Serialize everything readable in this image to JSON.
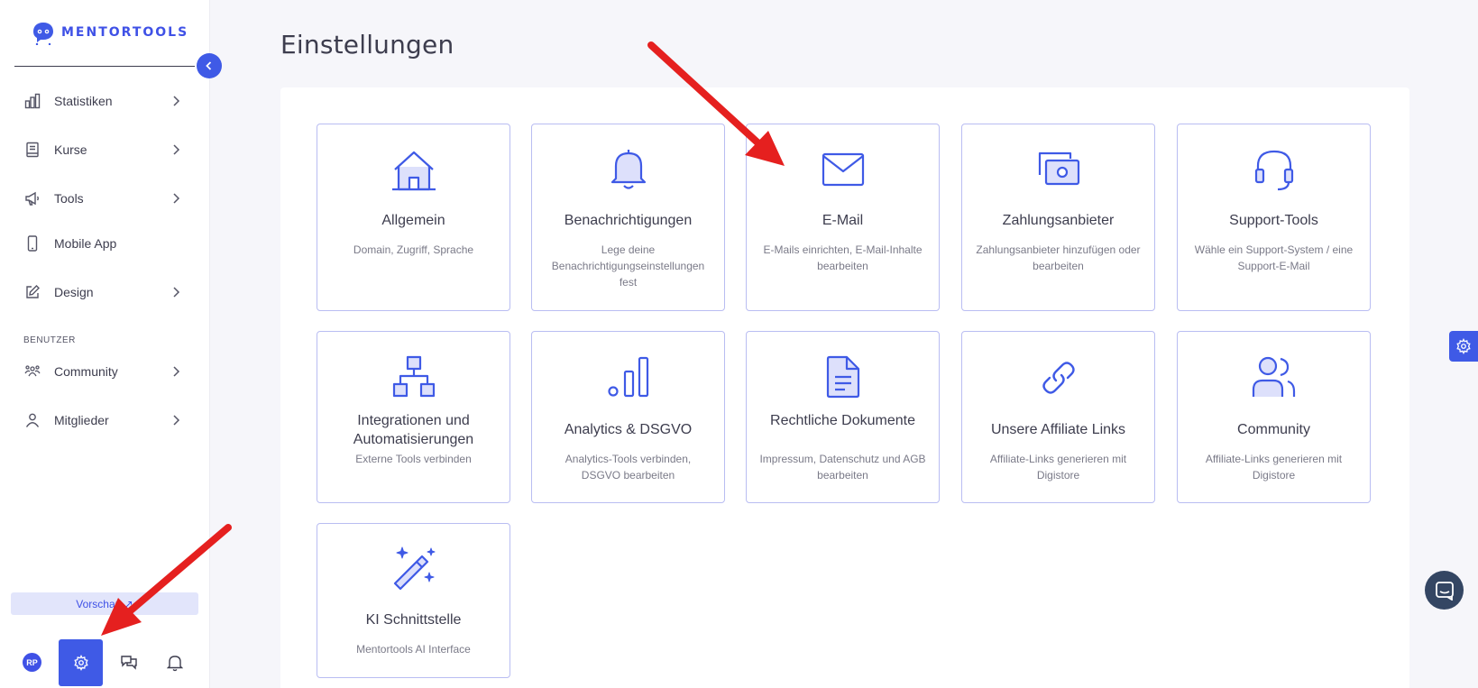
{
  "brand": {
    "name": "MENTORTOOLS",
    "accent": "#3f5ae6"
  },
  "sidebar": {
    "items": [
      {
        "label": "Statistiken",
        "icon": "bar-chart-icon"
      },
      {
        "label": "Kurse",
        "icon": "book-icon"
      },
      {
        "label": "Tools",
        "icon": "megaphone-icon"
      },
      {
        "label": "Mobile App",
        "icon": "smartphone-icon"
      },
      {
        "label": "Design",
        "icon": "pen-square-icon"
      }
    ],
    "section_label": "BENUTZER",
    "user_items": [
      {
        "label": "Community",
        "icon": "group-icon"
      },
      {
        "label": "Mitglieder",
        "icon": "user-icon"
      }
    ],
    "preview_label": "Vorschau ↗",
    "avatar_initials": "RP"
  },
  "page": {
    "title": "Einstellungen"
  },
  "cards": [
    {
      "title": "Allgemein",
      "desc": "Domain, Zugriff, Sprache",
      "icon": "home-icon"
    },
    {
      "title": "Benachrichtigungen",
      "desc": "Lege deine Benachrichtigungseinstellungen fest",
      "icon": "bell-icon"
    },
    {
      "title": "E-Mail",
      "desc": "E-Mails einrichten, E-Mail-Inhalte bearbeiten",
      "icon": "envelope-icon"
    },
    {
      "title": "Zahlungsanbieter",
      "desc": "Zahlungsanbieter hinzufügen oder bearbeiten",
      "icon": "cash-icon"
    },
    {
      "title": "Support-Tools",
      "desc": "Wähle ein Support-System / eine Support-E-Mail",
      "icon": "headset-icon"
    },
    {
      "title": "Integrationen und Automatisierungen",
      "desc": "Externe Tools verbinden",
      "icon": "hierarchy-icon"
    },
    {
      "title": "Analytics & DSGVO",
      "desc": "Analytics-Tools verbinden, DSGVO bearbeiten",
      "icon": "analytics-icon"
    },
    {
      "title": "Rechtliche Dokumente",
      "desc": "Impressum, Datenschutz und AGB bearbeiten",
      "icon": "document-icon"
    },
    {
      "title": "Unsere Affiliate Links",
      "desc": "Affiliate-Links generieren mit Digistore",
      "icon": "link-icon"
    },
    {
      "title": "Community",
      "desc": "Affiliate-Links generieren mit Digistore",
      "icon": "users-icon"
    },
    {
      "title": "KI Schnittstelle",
      "desc": "Mentortools AI Interface",
      "icon": "magic-wand-icon"
    }
  ]
}
